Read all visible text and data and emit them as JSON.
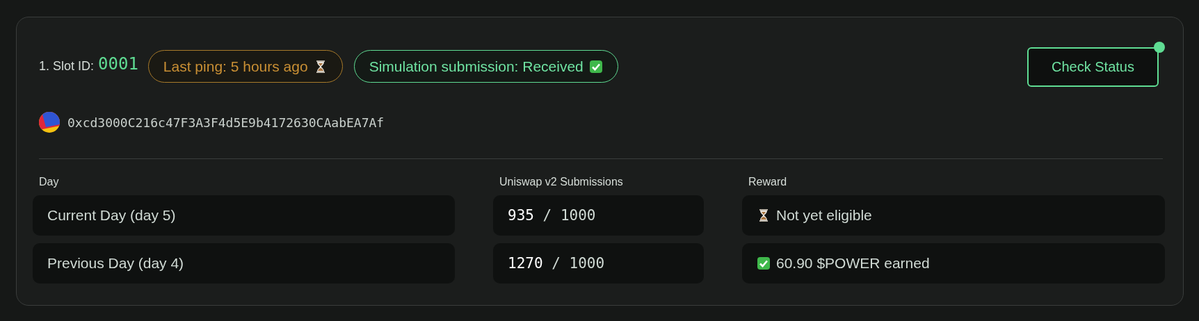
{
  "slot": {
    "label": "1. Slot ID:",
    "id": "0001"
  },
  "ping": {
    "text": "Last ping: 5 hours ago",
    "waiting": true
  },
  "submission": {
    "text": "Simulation submission: Received",
    "received": true
  },
  "check_button": {
    "label": "Check Status",
    "notification": true
  },
  "address": "0xcd3000C216c47F3A3F4d5E9b4172630CAabEA7Af",
  "table": {
    "columns": [
      "Day",
      "Uniswap v2 Submissions",
      "Reward"
    ],
    "rows": [
      {
        "day": "Current Day (day 5)",
        "count": "935",
        "limit": "/ 1000",
        "reward": "Not yet eligible",
        "eligible": false
      },
      {
        "day": "Previous Day (day 4)",
        "count": "1270",
        "limit": "/ 1000",
        "reward": "60.90 $POWER earned",
        "eligible": true
      }
    ]
  }
}
